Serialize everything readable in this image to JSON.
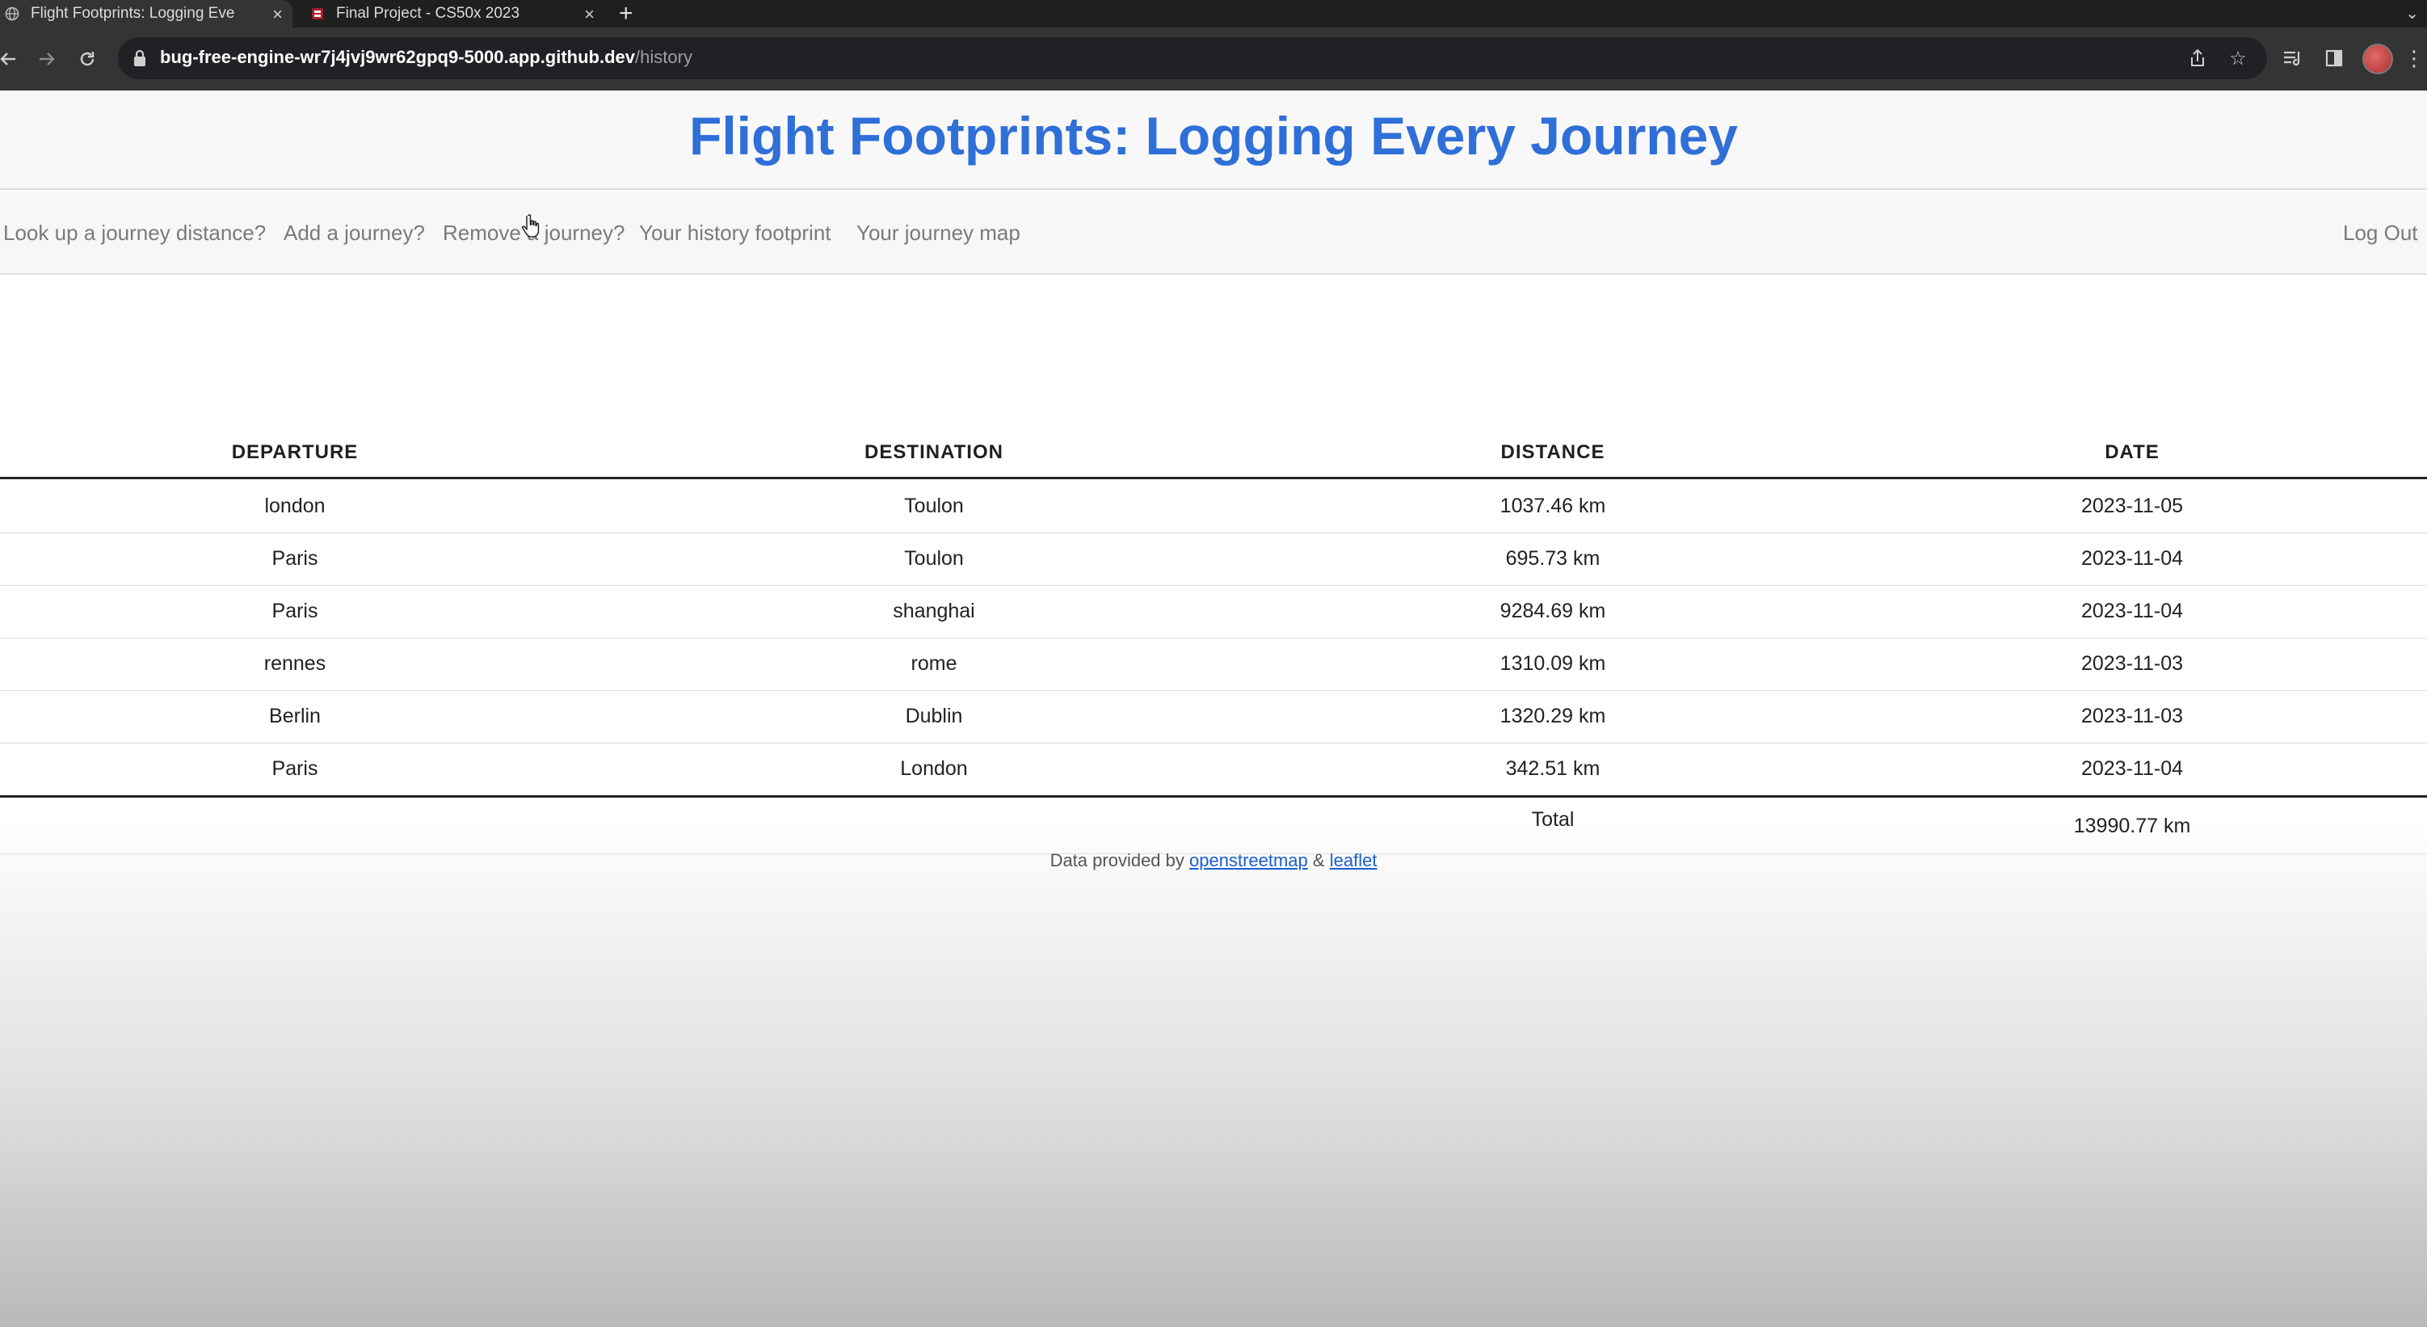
{
  "browser": {
    "tabs": [
      {
        "title": "Flight Footprints: Logging Eve",
        "active": true
      },
      {
        "title": "Final Project - CS50x 2023",
        "active": false
      }
    ],
    "url_host": "bug-free-engine-wr7j4jvj9wr62gpq9-5000.app.github.dev",
    "url_path": "/history"
  },
  "site": {
    "title": "Flight Footprints: Logging Every Journey",
    "nav": [
      "Look up a journey distance?",
      "Add a journey?",
      "Remove a journey?",
      "Your history footprint",
      "Your journey map"
    ],
    "logout": "Log Out"
  },
  "table": {
    "headers": [
      "DEPARTURE",
      "DESTINATION",
      "DISTANCE",
      "DATE"
    ],
    "rows": [
      [
        "london",
        "Toulon",
        "1037.46 km",
        "2023-11-05"
      ],
      [
        "Paris",
        "Toulon",
        "695.73 km",
        "2023-11-04"
      ],
      [
        "Paris",
        "shanghai",
        "9284.69 km",
        "2023-11-04"
      ],
      [
        "rennes",
        "rome",
        "1310.09 km",
        "2023-11-03"
      ],
      [
        "Berlin",
        "Dublin",
        "1320.29 km",
        "2023-11-03"
      ],
      [
        "Paris",
        "London",
        "342.51 km",
        "2023-11-04"
      ]
    ],
    "total_label": "Total",
    "total_value": "13990.77 km"
  },
  "footer": {
    "prefix": "Data provided by",
    "link1": "openstreetmap",
    "amp": "&",
    "link2": "leaflet"
  },
  "colors": {
    "title_blue": "#2f6fd8",
    "link_blue": "#1a5fcf"
  }
}
